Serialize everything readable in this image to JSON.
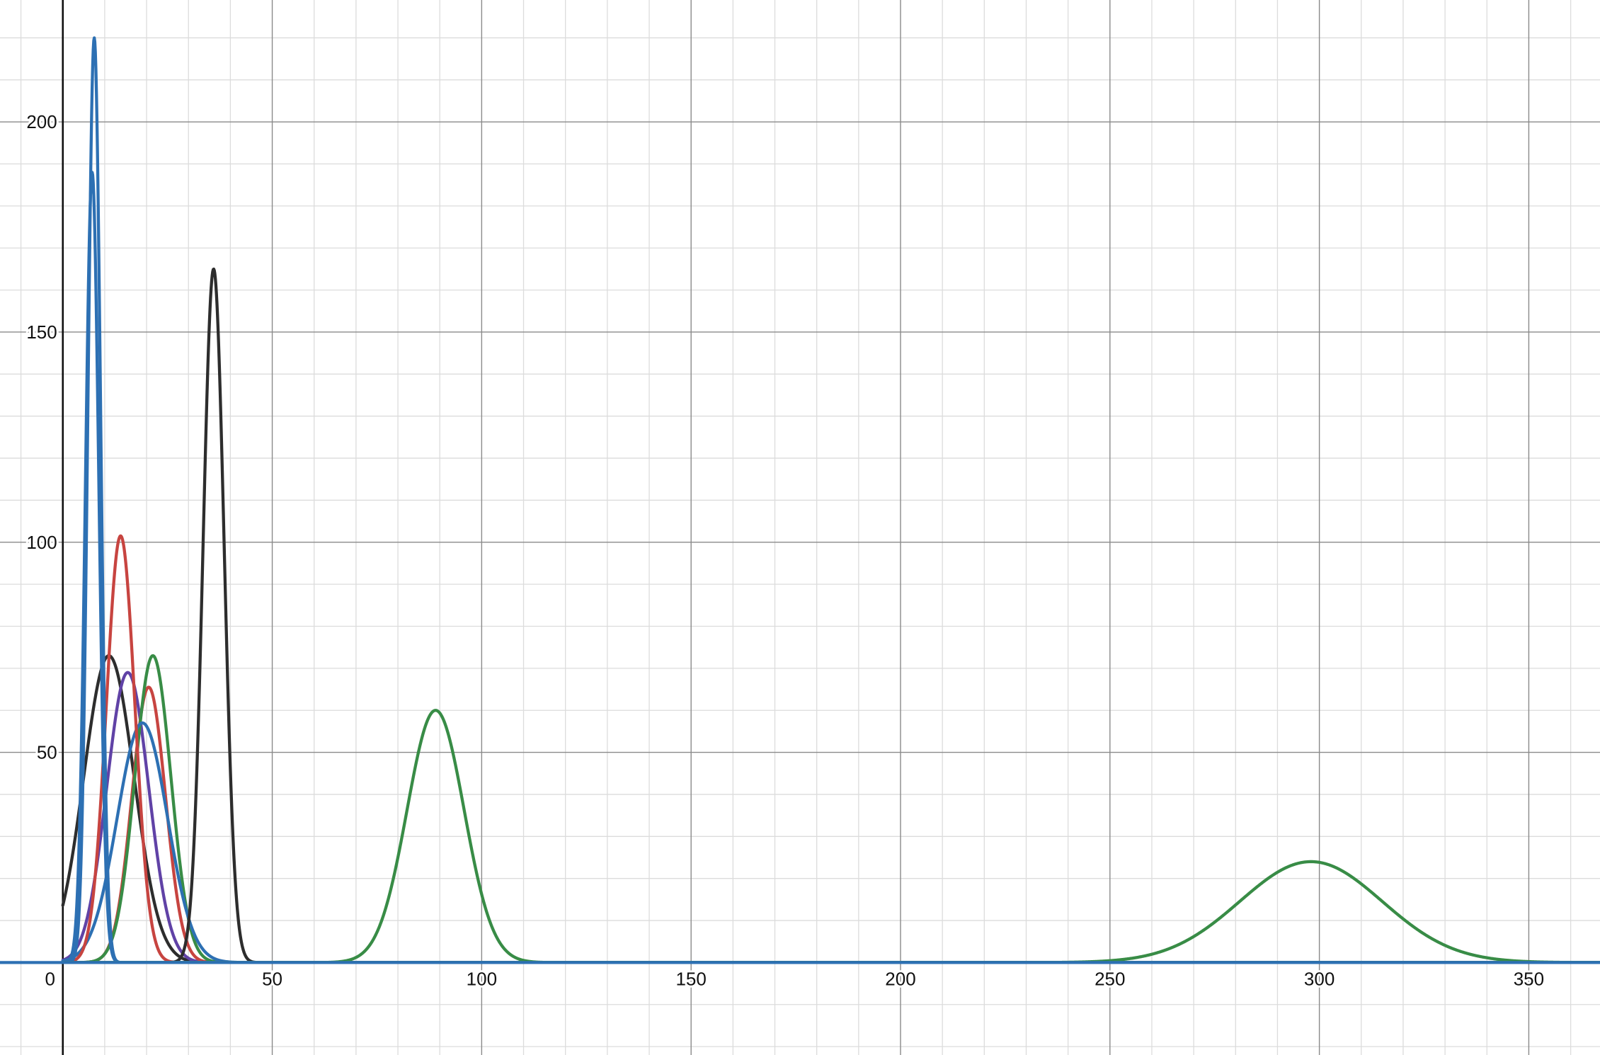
{
  "chart_data": {
    "type": "line",
    "title": "",
    "xlabel": "",
    "ylabel": "",
    "xlim": [
      -15,
      367
    ],
    "ylim": [
      -22,
      229
    ],
    "grid": true,
    "x_ticks": [
      {
        "value": 0,
        "label": "0"
      },
      {
        "value": 50,
        "label": "50"
      },
      {
        "value": 100,
        "label": "100"
      },
      {
        "value": 150,
        "label": "150"
      },
      {
        "value": 200,
        "label": "200"
      },
      {
        "value": 250,
        "label": "250"
      },
      {
        "value": 300,
        "label": "300"
      },
      {
        "value": 350,
        "label": "350"
      }
    ],
    "y_ticks": [
      {
        "value": 50,
        "label": "50"
      },
      {
        "value": 100,
        "label": "100"
      },
      {
        "value": 150,
        "label": "150"
      },
      {
        "value": 200,
        "label": "200"
      }
    ],
    "curve_shape": "gaussian",
    "series": [
      {
        "color": "#2d2d2d",
        "peak_x": 11,
        "peak_y": 73,
        "sigma": 6.0
      },
      {
        "color": "#6042a6",
        "peak_x": 15.5,
        "peak_y": 69,
        "sigma": 5.0
      },
      {
        "color": "#c74440",
        "peak_x": 20.5,
        "peak_y": 65.5,
        "sigma": 4.0
      },
      {
        "color": "#388c46",
        "peak_x": 21.5,
        "peak_y": 73,
        "sigma": 4.3
      },
      {
        "color": "#2d70b3",
        "peak_x": 19,
        "peak_y": 57,
        "sigma": 6.0
      },
      {
        "color": "#c74440",
        "peak_x": 13.8,
        "peak_y": 101.5,
        "sigma": 3.4
      },
      {
        "color": "#2d2d2d",
        "peak_x": 36,
        "peak_y": 165,
        "sigma": 2.5
      },
      {
        "color": "#2d70b3",
        "peak_x": 7,
        "peak_y": 188,
        "sigma": 1.6
      },
      {
        "color": "#2d70b3",
        "peak_x": 7.5,
        "peak_y": 220,
        "sigma": 1.5
      },
      {
        "color": "#388c46",
        "peak_x": 89,
        "peak_y": 60,
        "sigma": 6.8
      },
      {
        "color": "#388c46",
        "peak_x": 298,
        "peak_y": 24,
        "sigma": 17
      },
      {
        "color": "#2d70b3",
        "peak_x": 0,
        "peak_y": 0,
        "sigma": 1,
        "flat": true
      }
    ]
  }
}
